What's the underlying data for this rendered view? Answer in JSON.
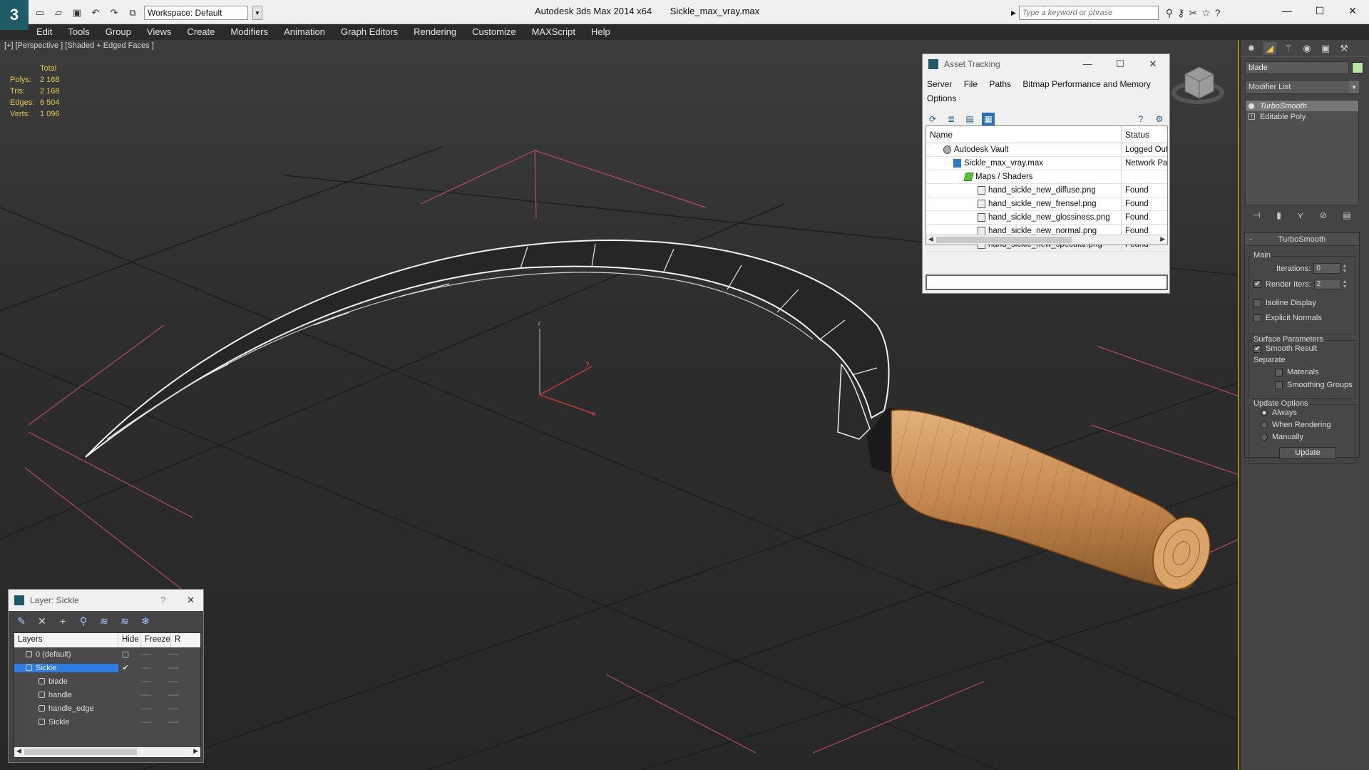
{
  "titlebar": {
    "app_name": "Autodesk 3ds Max  2014 x64",
    "file_name": "Sickle_max_vray.max",
    "workspace": "Workspace: Default",
    "search_placeholder": "Type a keyword or phrase"
  },
  "menu": [
    "Edit",
    "Tools",
    "Group",
    "Views",
    "Create",
    "Modifiers",
    "Animation",
    "Graph Editors",
    "Rendering",
    "Customize",
    "MAXScript",
    "Help"
  ],
  "viewport": {
    "label": "[+] [Perspective ] [Shaded + Edged Faces ]",
    "stats": {
      "header": "Total",
      "rows": [
        {
          "k": "Polys:",
          "v": "2 168"
        },
        {
          "k": "Tris:",
          "v": "2 168"
        },
        {
          "k": "Edges:",
          "v": "6 504"
        },
        {
          "k": "Verts:",
          "v": "1 096"
        }
      ]
    },
    "axes": {
      "x": "x",
      "y": "y",
      "z": "z"
    }
  },
  "asset_tracking": {
    "title": "Asset Tracking",
    "menu": [
      "Server",
      "File",
      "Paths",
      "Bitmap Performance and Memory",
      "Options"
    ],
    "columns": {
      "name": "Name",
      "status": "Status"
    },
    "rows": [
      {
        "name": "Autodesk Vault",
        "status": "Logged Out",
        "indent": 0,
        "icon": "vault"
      },
      {
        "name": "Sickle_max_vray.max",
        "status": "Network Path",
        "indent": 1,
        "icon": "max"
      },
      {
        "name": "Maps / Shaders",
        "status": "",
        "indent": 2,
        "icon": "maps"
      },
      {
        "name": "hand_sickle_new_diffuse.png",
        "status": "Found",
        "indent": 3,
        "icon": "file"
      },
      {
        "name": "hand_sickle_new_frensel.png",
        "status": "Found",
        "indent": 3,
        "icon": "file"
      },
      {
        "name": "hand_sickle_new_glossiness.png",
        "status": "Found",
        "indent": 3,
        "icon": "file"
      },
      {
        "name": "hand_sickle_new_normal.png",
        "status": "Found",
        "indent": 3,
        "icon": "file"
      },
      {
        "name": "hand_sickle_new_specular.png",
        "status": "Found",
        "indent": 3,
        "icon": "file"
      }
    ]
  },
  "layer_dialog": {
    "title": "Layer: Sickle",
    "help": "?",
    "columns": {
      "layers": "Layers",
      "hide": "Hide",
      "freeze": "Freeze",
      "render": "R"
    },
    "rows": [
      {
        "name": "0 (default)",
        "indent": 1,
        "selected": false,
        "flag": "▢"
      },
      {
        "name": "Sickle",
        "indent": 1,
        "selected": true,
        "flag": "✔"
      },
      {
        "name": "blade",
        "indent": 2,
        "selected": false,
        "flag": ""
      },
      {
        "name": "handle",
        "indent": 2,
        "selected": false,
        "flag": ""
      },
      {
        "name": "handle_edge",
        "indent": 2,
        "selected": false,
        "flag": ""
      },
      {
        "name": "Sickle",
        "indent": 2,
        "selected": false,
        "flag": ""
      }
    ],
    "dash": "----"
  },
  "command_panel": {
    "object_name": "blade",
    "object_color": "#b9e3a6",
    "modifier_list": "Modifier List",
    "stack": [
      {
        "name": "TurboSmooth",
        "active": true
      },
      {
        "name": "Editable Poly",
        "active": false
      }
    ],
    "rollout_title": "TurboSmooth",
    "main_group": "Main",
    "iterations_label": "Iterations:",
    "iterations_value": "0",
    "render_iters_label": "Render Iters:",
    "render_iters_value": "2",
    "isoline": "Isoline Display",
    "explicit_normals": "Explicit Normals",
    "surface_group": "Surface Parameters",
    "smooth_result": "Smooth Result",
    "separate": "Separate",
    "materials": "Materials",
    "smoothing_groups": "Smoothing Groups",
    "update_group": "Update Options",
    "always": "Always",
    "when_rendering": "When Rendering",
    "manually": "Manually",
    "update_button": "Update"
  },
  "colors": {
    "accent": "#2f7de1",
    "grid_highlight": "#d9507a",
    "stats_text": "#e6c94d",
    "handle_wood": "#c4884f"
  }
}
